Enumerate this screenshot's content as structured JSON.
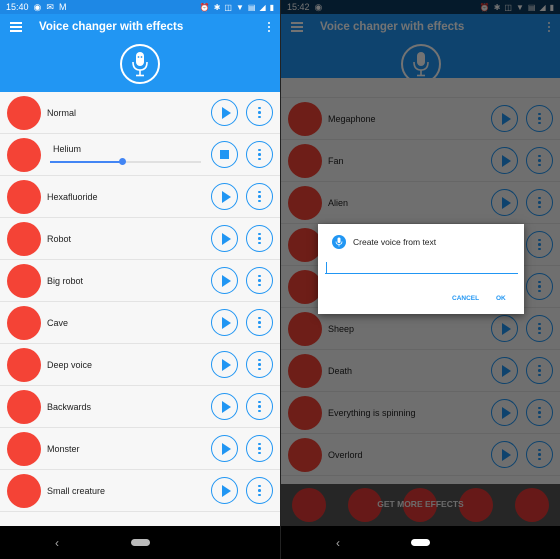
{
  "colors": {
    "primary": "#2196f3",
    "accent_red": "#f44336",
    "status_bar": "#1e88e5"
  },
  "left": {
    "status": {
      "time": "15:40",
      "left_icons": [
        "spotify-icon",
        "message-icon",
        "gmail-icon"
      ],
      "right_icons": [
        "alarm-icon",
        "bluetooth-icon",
        "vibrate-icon",
        "wifi-icon",
        "volte-icon",
        "signal-icon",
        "battery-icon"
      ]
    },
    "appbar": {
      "title": "Voice changer with effects"
    },
    "effects": [
      {
        "name": "Normal",
        "icon": "robot-face-icon",
        "state": "idle"
      },
      {
        "name": "Helium",
        "icon": "balloon-icon",
        "state": "playing",
        "progress": 0.48
      },
      {
        "name": "Hexafluoride",
        "icon": "drop-icon",
        "state": "idle"
      },
      {
        "name": "Robot",
        "icon": "robot-icon",
        "state": "idle"
      },
      {
        "name": "Big robot",
        "icon": "big-robot-icon",
        "state": "idle"
      },
      {
        "name": "Cave",
        "icon": "cave-icon",
        "state": "idle"
      },
      {
        "name": "Deep voice",
        "icon": "devil-icon",
        "state": "idle"
      },
      {
        "name": "Backwards",
        "icon": "rewind-icon",
        "state": "idle"
      },
      {
        "name": "Monster",
        "icon": "monster-icon",
        "state": "idle"
      },
      {
        "name": "Small creature",
        "icon": "creature-icon",
        "state": "idle"
      }
    ]
  },
  "right": {
    "status": {
      "time": "15:42",
      "left_icons": [
        "spotify-icon"
      ],
      "right_icons": [
        "alarm-icon",
        "bluetooth-icon",
        "vibrate-icon",
        "wifi-icon",
        "volte-icon",
        "signal-icon",
        "battery-icon"
      ]
    },
    "appbar": {
      "title": "Voice changer with effects"
    },
    "effects": [
      {
        "name": "Megaphone",
        "icon": "megaphone-icon"
      },
      {
        "name": "Fan",
        "icon": "fan-icon"
      },
      {
        "name": "Alien",
        "icon": "alien-icon"
      },
      {
        "name": "",
        "icon": "hidden-icon"
      },
      {
        "name": "",
        "icon": "hidden-icon"
      },
      {
        "name": "Sheep",
        "icon": "sheep-icon"
      },
      {
        "name": "Death",
        "icon": "skull-icon"
      },
      {
        "name": "Everything is spinning",
        "icon": "dizzy-icon"
      },
      {
        "name": "Overlord",
        "icon": "overlord-icon"
      }
    ],
    "get_more": "GET MORE EFFECTS",
    "dialog": {
      "title": "Create voice from text",
      "value": "",
      "placeholder": "",
      "cancel": "CANCEL",
      "ok": "OK"
    }
  },
  "nav": {
    "back": "‹"
  }
}
